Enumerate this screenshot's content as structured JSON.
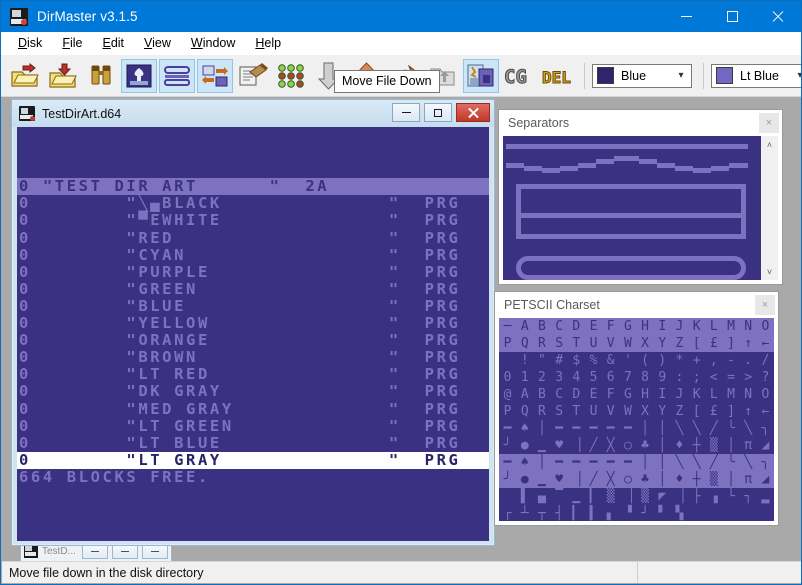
{
  "window": {
    "title": "DirMaster v3.1.5",
    "app_icon": "disk-drive-icon",
    "minimize": "minimize-button",
    "maximize": "maximize-button",
    "close": "close-button"
  },
  "menubar": {
    "items": [
      {
        "label": "Disk",
        "accel": "D"
      },
      {
        "label": "File",
        "accel": "F"
      },
      {
        "label": "Edit",
        "accel": "E"
      },
      {
        "label": "View",
        "accel": "V"
      },
      {
        "label": "Window",
        "accel": "W"
      },
      {
        "label": "Help",
        "accel": "H"
      }
    ]
  },
  "toolbar": {
    "buttons": [
      {
        "name": "open-disk-icon",
        "active": false
      },
      {
        "name": "save-disk-icon",
        "active": false
      },
      {
        "name": "find-files-icon",
        "active": false
      },
      {
        "name": "view-image-icon",
        "active": true
      },
      {
        "name": "view-list-icon",
        "active": true
      },
      {
        "name": "convert-icon",
        "active": true
      },
      {
        "name": "edit-bam-icon",
        "active": false
      },
      {
        "name": "disk-sectors-icon",
        "active": false
      },
      {
        "name": "move-file-down-icon",
        "active": false
      },
      {
        "name": "move-file-up-icon",
        "active": false
      },
      {
        "name": "redo-icon",
        "active": false
      },
      {
        "name": "parent-folder-icon",
        "active": false
      },
      {
        "name": "dir-art-icon",
        "active": true
      },
      {
        "name": "charset-cg-icon",
        "active": false
      },
      {
        "name": "delete-del-icon",
        "active": false
      }
    ],
    "background_color_combo": {
      "name": "background-color-select",
      "value": "Blue",
      "swatch": "#2e2470"
    },
    "foreground_color_combo": {
      "name": "foreground-color-select",
      "value": "Lt Blue",
      "swatch": "#7168c4"
    }
  },
  "tooltip": {
    "text": "Move File Down"
  },
  "mdi_child": {
    "title": "TestDirArt.d64",
    "icon": "disk-image-icon",
    "minimize": "minimize-button",
    "restore": "restore-button",
    "close": "close-button",
    "screen_colors": {
      "background": "#3b3183",
      "foreground": "#7e72c0",
      "selected_background": "#ffffff",
      "selected_foreground": "#2a2266"
    },
    "directory": {
      "header": "0 \"TEST DIR ART      \"  2A",
      "entries": [
        {
          "blocks": "0",
          "name": "\"╲▄BLACK",
          "type": "\"  PRG",
          "selected": false
        },
        {
          "blocks": "0",
          "name": "\"▀EWHITE",
          "type": "\"  PRG",
          "selected": false
        },
        {
          "blocks": "0",
          "name": "\"RED",
          "type": "\"  PRG",
          "selected": false
        },
        {
          "blocks": "0",
          "name": "\"CYAN",
          "type": "\"  PRG",
          "selected": false
        },
        {
          "blocks": "0",
          "name": "\"PURPLE",
          "type": "\"  PRG",
          "selected": false
        },
        {
          "blocks": "0",
          "name": "\"GREEN",
          "type": "\"  PRG",
          "selected": false
        },
        {
          "blocks": "0",
          "name": "\"BLUE",
          "type": "\"  PRG",
          "selected": false
        },
        {
          "blocks": "0",
          "name": "\"YELLOW",
          "type": "\"  PRG",
          "selected": false
        },
        {
          "blocks": "0",
          "name": "\"ORANGE",
          "type": "\"  PRG",
          "selected": false
        },
        {
          "blocks": "0",
          "name": "\"BROWN",
          "type": "\"  PRG",
          "selected": false
        },
        {
          "blocks": "0",
          "name": "\"LT RED",
          "type": "\"  PRG",
          "selected": false
        },
        {
          "blocks": "0",
          "name": "\"DK GRAY",
          "type": "\"  PRG",
          "selected": false
        },
        {
          "blocks": "0",
          "name": "\"MED GRAY",
          "type": "\"  PRG",
          "selected": false
        },
        {
          "blocks": "0",
          "name": "\"LT GREEN",
          "type": "\"  PRG",
          "selected": false
        },
        {
          "blocks": "0",
          "name": "\"LT BLUE",
          "type": "\"  PRG",
          "selected": false
        },
        {
          "blocks": "0",
          "name": "\"LT GRAY",
          "type": "\"  PRG",
          "selected": true
        }
      ],
      "footer": "664 BLOCKS FREE."
    }
  },
  "mdi_child_minimized": {
    "title": "TestD...",
    "icon": "disk-image-icon"
  },
  "dock_separators": {
    "title": "Separators",
    "close": "×",
    "scroll_up": "˄",
    "scroll_down": "˅"
  },
  "dock_charset": {
    "title": "PETSCII Charset",
    "close": "×",
    "rows": [
      {
        "reverse": true,
        "chars": [
          "─",
          "A",
          "B",
          "C",
          "D",
          "E",
          "F",
          "G",
          "H",
          "I",
          "J",
          "K",
          "L",
          "M",
          "N",
          "O"
        ]
      },
      {
        "reverse": true,
        "chars": [
          "P",
          "Q",
          "R",
          "S",
          "T",
          "U",
          "V",
          "W",
          "X",
          "Y",
          "Z",
          "[",
          "£",
          "]",
          "↑",
          "←"
        ]
      },
      {
        "reverse": false,
        "chars": [
          " ",
          "!",
          "\"",
          "#",
          "$",
          "%",
          "&",
          "'",
          "(",
          ")",
          "*",
          "+",
          ",",
          "-",
          ".",
          "/"
        ]
      },
      {
        "reverse": false,
        "chars": [
          "0",
          "1",
          "2",
          "3",
          "4",
          "5",
          "6",
          "7",
          "8",
          "9",
          ":",
          ";",
          "<",
          "=",
          ">",
          "?"
        ]
      },
      {
        "reverse": false,
        "chars": [
          "@",
          "A",
          "B",
          "C",
          "D",
          "E",
          "F",
          "G",
          "H",
          "I",
          "J",
          "K",
          "L",
          "M",
          "N",
          "O"
        ]
      },
      {
        "reverse": false,
        "chars": [
          "P",
          "Q",
          "R",
          "S",
          "T",
          "U",
          "V",
          "W",
          "X",
          "Y",
          "Z",
          "[",
          "£",
          "]",
          "↑",
          "←"
        ]
      },
      {
        "reverse": false,
        "chars": [
          "━",
          "♠",
          "│",
          "━",
          "━",
          "━",
          "━",
          "━",
          "│",
          "│",
          "╲",
          "╲",
          "╱",
          "╰",
          "╲",
          "╮"
        ]
      },
      {
        "reverse": false,
        "chars": [
          "╯",
          "●",
          "▁",
          "♥",
          "▕",
          "╱",
          "╳",
          "○",
          "♣",
          "│",
          "♦",
          "┼",
          "▒",
          "│",
          "π",
          "◢"
        ]
      },
      {
        "reverse": true,
        "chars": [
          "━",
          "♠",
          "│",
          "━",
          "━",
          "━",
          "━",
          "━",
          "│",
          "│",
          "╲",
          "╲",
          "╱",
          "╰",
          "╲",
          "╮"
        ]
      },
      {
        "reverse": true,
        "chars": [
          "╯",
          "●",
          "▁",
          "♥",
          "▕",
          "╱",
          "╳",
          "○",
          "♣",
          "│",
          "♦",
          "┼",
          "▒",
          "│",
          "π",
          "◢"
        ]
      },
      {
        "reverse": false,
        "chars": [
          " ",
          "▌",
          "▄",
          "▔",
          "▁",
          "▎",
          "▒",
          "▕",
          "▒",
          "◤",
          "▕",
          "├",
          "▗",
          "└",
          "┐",
          "▂"
        ]
      },
      {
        "reverse": false,
        "chars": [
          "┌",
          "┴",
          "┬",
          "┤",
          "▎",
          "▍",
          "▖",
          "▝",
          "┘",
          "▘",
          "▚",
          " ",
          " ",
          " ",
          " ",
          " "
        ]
      }
    ]
  },
  "statusbar": {
    "text": "Move file down in the disk directory"
  }
}
